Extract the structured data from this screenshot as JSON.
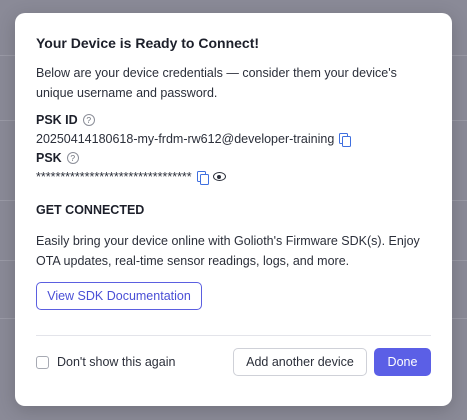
{
  "modal": {
    "title": "Your Device is Ready to Connect!",
    "intro": "Below are your device credentials — consider them your device's unique username and password."
  },
  "credentials": {
    "psk_id": {
      "label": "PSK ID",
      "help_glyph": "?",
      "value": "20250414180618-my-frdm-rw612@developer-training",
      "copy_icon": "copy-icon"
    },
    "psk": {
      "label": "PSK",
      "help_glyph": "?",
      "value": "********************************",
      "copy_icon": "copy-icon",
      "reveal_icon": "eye-icon"
    }
  },
  "get_connected": {
    "title": "GET CONNECTED",
    "description": "Easily bring your device online with Golioth's Firmware SDK(s). Enjoy OTA updates, real-time sensor readings, logs, and more.",
    "docs_button": "View SDK Documentation"
  },
  "footer": {
    "dont_show_label": "Don't show this again",
    "dont_show_checked": false,
    "add_device_button": "Add another device",
    "done_button": "Done"
  },
  "colors": {
    "primary": "#5b5fe6",
    "link_icon": "#3f6fdf",
    "backdrop": "#8a8a97"
  }
}
